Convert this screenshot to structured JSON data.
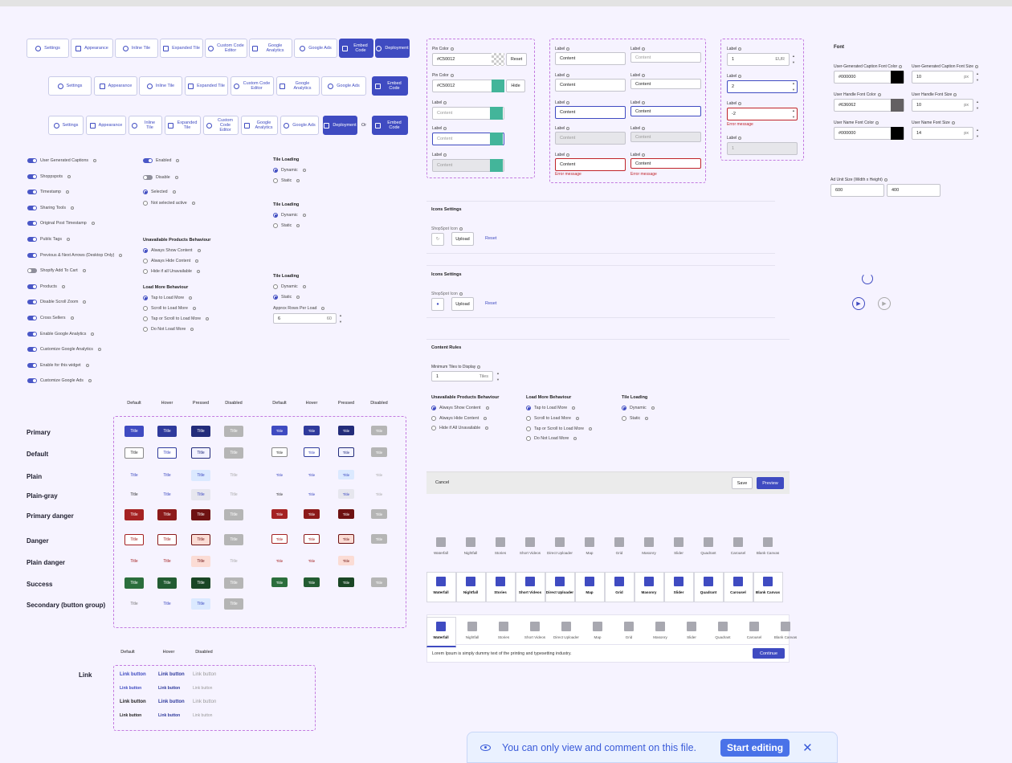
{
  "tabs_row1": [
    "Settings",
    "Appearance",
    "Inline Tile",
    "Expanded Tile",
    "Custom Code Editor",
    "Google Analytics",
    "Google Ads",
    "Embed Code",
    "Deployment"
  ],
  "tabs_row2": [
    "Settings",
    "Appearance",
    "Inline Tile",
    "Expanded Tile",
    "Custom Code Editor",
    "Google Analytics",
    "Google Ads",
    "Embed Code"
  ],
  "tabs_row3": [
    "Settings",
    "Appearance",
    "Inline Tile",
    "Expanded Tile",
    "Custom Code Editor",
    "Google Analytics",
    "Google Ads",
    "Deployment",
    "Or",
    "Embed Code"
  ],
  "toggles": [
    "User Generated Captions",
    "Shoppspots",
    "Timestamp",
    "Sharing Tools",
    "Original Post Timestamp",
    "Public Tags",
    "Previous & Next Arrows (Desktop Only)",
    "Shopify Add To Cart",
    "Products",
    "Disable Scroll Zoom",
    "Cross Sellers",
    "Enable Google Analytics",
    "Customize Google Analytics",
    "Enable for this widget",
    "Customize Google Ads"
  ],
  "toggle_states": [
    "on",
    "on",
    "on",
    "on",
    "on",
    "on",
    "on",
    "off",
    "on",
    "on",
    "on",
    "on",
    "on",
    "on",
    "on"
  ],
  "misc_controls": {
    "enabled": "Enabled",
    "disable": "Disable",
    "selected": "Selected",
    "not_selected": "Not selected active"
  },
  "unavail_title": "Unavailable Products Behaviour",
  "unavail_options": [
    "Always Show Content",
    "Always Hide Content",
    "Hide if all Unavailable"
  ],
  "loadmore_title": "Load More Behaviour",
  "loadmore_options": [
    "Tap to Load More",
    "Scroll to Load More",
    "Tap or Scroll to Load More",
    "Do Not Load More"
  ],
  "tile_loading": {
    "title": "Tile Loading",
    "dynamic": "Dynamic",
    "static": "Static",
    "approx_label": "Approx Rows Per Load",
    "approx_value": "6",
    "approx_max": "60"
  },
  "matrix": {
    "headers": [
      "Default",
      "Hover",
      "Pressed",
      "Disabled",
      "Default",
      "Hover",
      "Pressed",
      "Disabled"
    ],
    "rows": [
      "Primary",
      "Default",
      "Plain",
      "Plain-gray",
      "Primary danger",
      "Danger",
      "Plain danger",
      "Success",
      "Secondary (button group)"
    ],
    "btn_label": "Title"
  },
  "link": {
    "row_label": "Link",
    "headers": [
      "Default",
      "Hover",
      "Disabled"
    ],
    "btn_label": "Link button"
  },
  "pin": {
    "pin_color": "Pin Color",
    "hex": "#C50012",
    "reset": "Reset",
    "hide": "Hide",
    "label": "Label",
    "content": "Content"
  },
  "fields": {
    "label": "Label",
    "content": "Content",
    "error": "Error message",
    "eur": "EUR",
    "v1": "1",
    "v2": "2",
    "v3": "-2",
    "v4": "1"
  },
  "font_panel": {
    "title": "Font",
    "caption_color": "User-Generated Caption Font Color",
    "caption_size": "User-Generated Caption Font Size",
    "handle_color": "User Handle Font Color",
    "handle_size": "User Handle Font Size",
    "name_color": "User Name Font Color",
    "name_size": "User Name Font Size",
    "c1": "#000000",
    "c2": "#636062",
    "c3": "#000000",
    "s1": "10",
    "s2": "10",
    "s3": "14",
    "px": "px",
    "ad_label": "Ad Unit Size (Width x Height)",
    "ad_w": "600",
    "ad_h": "400"
  },
  "icons_settings": {
    "title": "Icons Settings",
    "label": "ShopSpot Icon",
    "upload": "Upload",
    "reset": "Reset"
  },
  "content_rules": {
    "title": "Content Rules",
    "min_label": "Minimum Tiles to Display",
    "min_value": "1",
    "min_unit": "Tiles",
    "unavail_title": "Unavailable Products Behaviour",
    "unavail_options": [
      "Always Show Content",
      "Always Hide Content",
      "Hide if All Unavailable"
    ],
    "tile_title": "Tile Loading",
    "tile_options": [
      "Dynamic",
      "Static"
    ]
  },
  "footer": {
    "cancel": "Cancel",
    "save": "Save",
    "preview": "Preview"
  },
  "templates": [
    "Waterfall",
    "Nightfall",
    "Stories",
    "Short Videos",
    "Direct Uploader",
    "Map",
    "Grid",
    "Masonry",
    "Slider",
    "Quadrant",
    "Carousel",
    "Blank Canvas"
  ],
  "template_desc": "Lorem Ipsum is simply dummy text of the printing and typesetting industry.",
  "continue": "Continue",
  "toast": {
    "message": "You can only view and comment on this file.",
    "action": "Start editing"
  },
  "colors": {
    "primary": "#3f4bc1",
    "danger": "#a52222",
    "success": "#2b6e3c",
    "dashed": "#c37be0"
  }
}
